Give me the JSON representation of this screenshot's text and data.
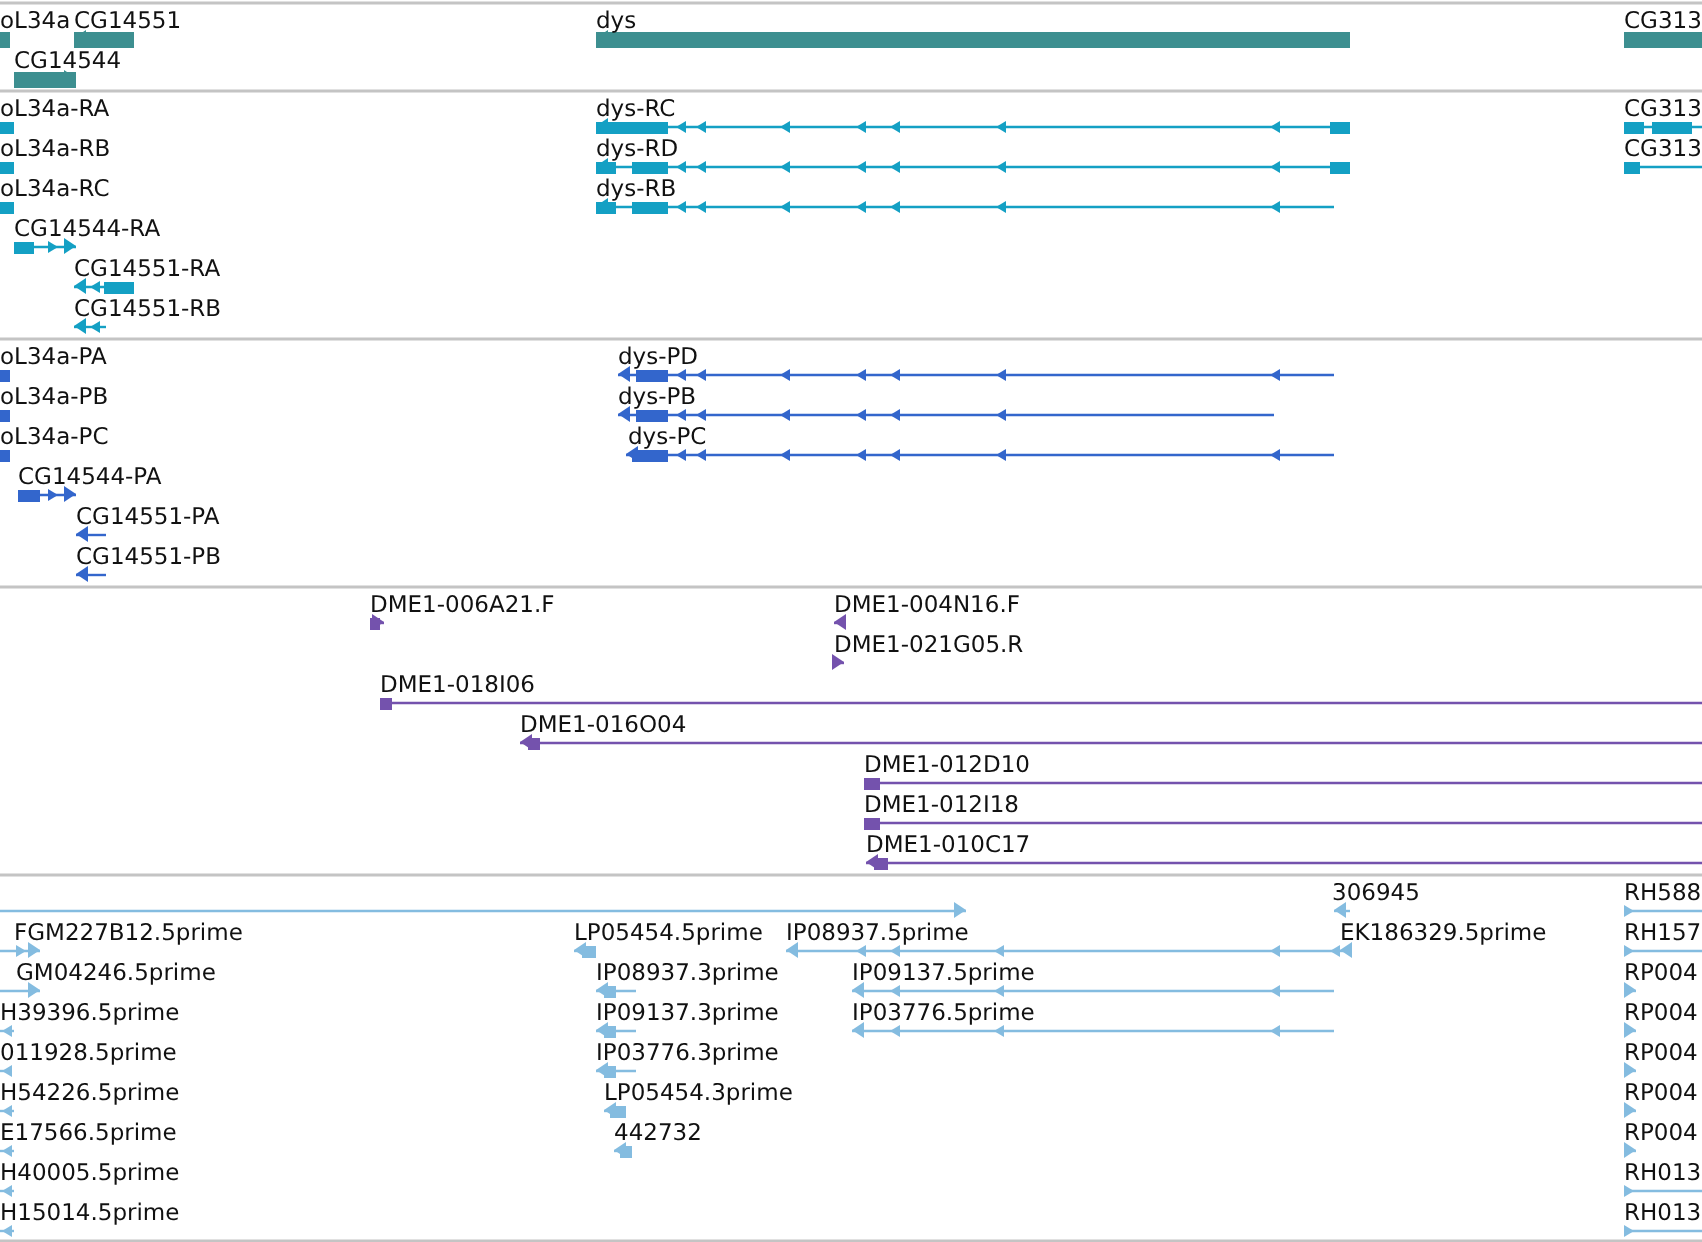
{
  "tracks": [
    {
      "color": "#3d8f90",
      "features": [
        {
          "label": "oL34a",
          "reverse": true
        },
        {
          "label": "CG14551",
          "reverse": true
        },
        {
          "label": "dys",
          "reverse": true
        },
        {
          "label": "CG313",
          "reverse": false
        },
        {
          "label": "CG14544",
          "reverse": false
        }
      ]
    },
    {
      "color": "#14a0c4",
      "features": [
        {
          "label": "oL34a-RA",
          "reverse": true
        },
        {
          "label": "dys-RC",
          "reverse": true
        },
        {
          "label": "CG313",
          "reverse": false
        },
        {
          "label": "oL34a-RB",
          "reverse": true
        },
        {
          "label": "dys-RD",
          "reverse": true
        },
        {
          "label": "CG313",
          "reverse": false
        },
        {
          "label": "oL34a-RC",
          "reverse": true
        },
        {
          "label": "dys-RB",
          "reverse": true
        },
        {
          "label": "CG14544-RA",
          "reverse": false
        },
        {
          "label": "CG14551-RA",
          "reverse": true
        },
        {
          "label": "CG14551-RB",
          "reverse": true
        }
      ]
    },
    {
      "color": "#3366cc",
      "features": [
        {
          "label": "oL34a-PA",
          "reverse": true
        },
        {
          "label": "dys-PD",
          "reverse": true
        },
        {
          "label": "oL34a-PB",
          "reverse": true
        },
        {
          "label": "dys-PB",
          "reverse": true
        },
        {
          "label": "oL34a-PC",
          "reverse": true
        },
        {
          "label": "dys-PC",
          "reverse": true
        },
        {
          "label": "CG14544-PA",
          "reverse": false
        },
        {
          "label": "CG14551-PA",
          "reverse": true
        },
        {
          "label": "CG14551-PB",
          "reverse": true
        }
      ]
    },
    {
      "color": "#7452ad",
      "features": [
        {
          "label": "DME1-006A21.F",
          "reverse": false
        },
        {
          "label": "DME1-004N16.F",
          "reverse": true
        },
        {
          "label": "DME1-021G05.R",
          "reverse": false
        },
        {
          "label": "DME1-018I06",
          "reverse": false
        },
        {
          "label": "DME1-016O04",
          "reverse": true
        },
        {
          "label": "DME1-012D10",
          "reverse": false
        },
        {
          "label": "DME1-012I18",
          "reverse": false
        },
        {
          "label": "DME1-010C17",
          "reverse": true
        }
      ]
    },
    {
      "color": "#84bce0",
      "features": [
        {
          "reverse": false
        },
        {
          "label": "306945",
          "reverse": true
        },
        {
          "label": "RH588",
          "reverse": false
        },
        {
          "label": "FGM227B12.5prime",
          "reverse": false
        },
        {
          "label": "LP05454.5prime",
          "reverse": true
        },
        {
          "label": "IP08937.5prime",
          "reverse": true
        },
        {
          "label": "EK186329.5prime",
          "reverse": true
        },
        {
          "label": "RH157",
          "reverse": false
        },
        {
          "label": "GM04246.5prime",
          "reverse": false
        },
        {
          "label": "IP08937.3prime",
          "reverse": true
        },
        {
          "label": "IP09137.5prime",
          "reverse": true
        },
        {
          "label": "RP004",
          "reverse": false
        },
        {
          "label": "H39396.5prime",
          "reverse": true
        },
        {
          "label": "IP09137.3prime",
          "reverse": true
        },
        {
          "label": "IP03776.5prime",
          "reverse": true
        },
        {
          "label": "RP004",
          "reverse": false
        },
        {
          "label": "011928.5prime",
          "reverse": true
        },
        {
          "label": "IP03776.3prime",
          "reverse": true
        },
        {
          "label": "RP004",
          "reverse": false
        },
        {
          "label": "H54226.5prime",
          "reverse": true
        },
        {
          "label": "LP05454.3prime",
          "reverse": true
        },
        {
          "label": "RP004",
          "reverse": false
        },
        {
          "label": "E17566.5prime",
          "reverse": true
        },
        {
          "label": "442732",
          "reverse": true
        },
        {
          "label": "RP004",
          "reverse": false
        },
        {
          "label": "H40005.5prime",
          "reverse": true
        },
        {
          "label": "RH013",
          "reverse": false
        },
        {
          "label": "H15014.5prime",
          "reverse": true
        },
        {
          "label": "RH013",
          "reverse": false
        }
      ]
    }
  ]
}
